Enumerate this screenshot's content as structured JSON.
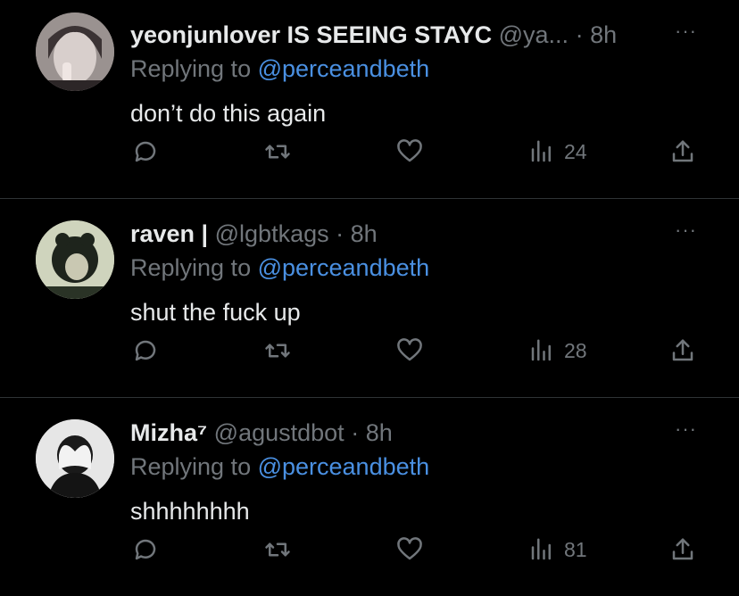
{
  "tweets": [
    {
      "name": "yeonjunlover IS SEEING STAYC",
      "handle": "@ya...",
      "dot": "·",
      "time": "8h",
      "more": "···",
      "replying_prefix": "Replying to ",
      "replying_to": "@perceandbeth",
      "text": "don’t do this again",
      "views": "24"
    },
    {
      "name": "raven |",
      "handle": "@lgbtkags",
      "dot": "·",
      "time": "8h",
      "more": "···",
      "replying_prefix": "Replying to ",
      "replying_to": "@perceandbeth",
      "text": "shut the fuck up",
      "views": "28"
    },
    {
      "name": "Mizha⁷",
      "handle": "@agustdbot",
      "dot": "·",
      "time": "8h",
      "more": "···",
      "replying_prefix": "Replying to ",
      "replying_to": "@perceandbeth",
      "text": "shhhhhhhh",
      "views": "81"
    }
  ],
  "colors": {
    "background": "#000000",
    "link": "#4a90e2",
    "muted": "#71767b",
    "text": "#e7e9ea"
  }
}
